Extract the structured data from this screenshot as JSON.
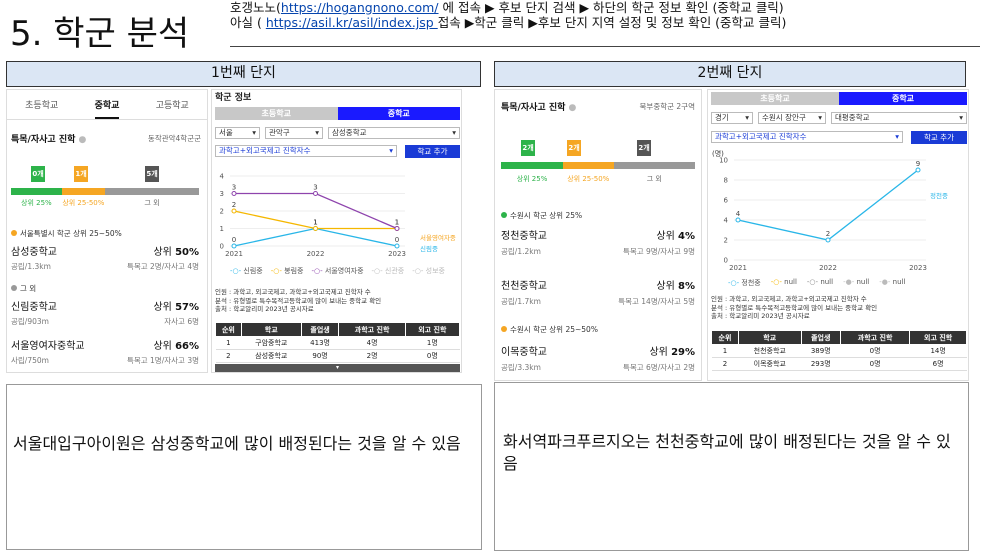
{
  "page": {
    "title": "5. 학군 분석",
    "instruction_line1_pre": "호갱노노(",
    "instruction_line1_link": "https://hogangnono.com/",
    "instruction_line1_post": " 에 접속 ▶ 후보 단지 검색 ▶ 하단의 학군 정보 확인 (중학교 클릭)",
    "instruction_line2_pre": "아실 ( ",
    "instruction_line2_link": "https://asil.kr/asil/index.jsp ",
    "instruction_line2_post": "접속 ▶학군 클릭 ▶후보 단지 지역 설정 및 정보 확인 (중학교 클릭)"
  },
  "panel1": {
    "heading": "1번째 단지",
    "tabs": [
      "초등학교",
      "중학교",
      "고등학교"
    ],
    "section_title": "특목/자사고 진학",
    "district": "동작관악4학군군",
    "flags": [
      "0개",
      "1개",
      "5개"
    ],
    "legend": [
      "상위 25%",
      "상위 25-50%",
      "그 외"
    ],
    "group1_label": "서울특별시 학군 상위 25~50%",
    "group2_label": "그 외",
    "schools": [
      {
        "name": "삼성중학교",
        "pct_prefix": "상위 ",
        "pct": "50%",
        "meta_left": "공립/1.3km",
        "meta_right": "특목고 2명/자사고 4명"
      },
      {
        "name": "신림중학교",
        "pct_prefix": "상위 ",
        "pct": "57%",
        "meta_left": "공립/903m",
        "meta_right": "자사고 6명"
      },
      {
        "name": "서울영여자중학교",
        "pct_prefix": "상위 ",
        "pct": "66%",
        "meta_left": "사립/750m",
        "meta_right": "특목고 1명/자사고 3명"
      }
    ],
    "asil": {
      "title": "학군 정보",
      "seg_left": "초등학교",
      "seg_right": "중학교",
      "sel1": "서울",
      "sel2": "관악구",
      "sel3": "삼성중학교",
      "sel_metric": "과학고+외고국제고 진학자수",
      "add_button": "학교 추가",
      "series_labels": [
        "서울영여자중",
        "신림중"
      ],
      "legend": [
        "신림중",
        "봉림중",
        "서울영여자중",
        "신관중",
        "성보중"
      ],
      "notes": [
        "인원 : 과학고, 외고국제고, 과학고+외고국제고 진학자 수",
        "분석 : 유형별로 특수목적고등학교에 많이 보내는 중학교 확인",
        "출처 : 학교알리미 2023년 공시자료"
      ],
      "table_headers": [
        "순위",
        "학교",
        "졸업생",
        "과학고 진학",
        "외고 진학"
      ],
      "table_rows": [
        [
          "1",
          "구암중학교",
          "413명",
          "4명",
          "1명"
        ],
        [
          "2",
          "삼성중학교",
          "90명",
          "2명",
          "0명"
        ]
      ]
    },
    "conclusion": "서울대입구아이원은 삼성중학교에 많이 배정된다는 것을 알 수 있음"
  },
  "panel2": {
    "heading": "2번째 단지",
    "section_title": "특목/자사고 진학",
    "district": "북부중학군 2구역",
    "flags": [
      "2개",
      "2개",
      "2개"
    ],
    "legend": [
      "상위 25%",
      "상위 25-50%",
      "그 외"
    ],
    "group1_label": "수원시 학군 상위 25%",
    "group2_label": "수원시 학군 상위 25~50%",
    "schools": [
      {
        "name": "정천중학교",
        "pct_prefix": "상위 ",
        "pct": "4%",
        "meta_left": "공립/1.2km",
        "meta_right": "특목고 9명/자사고 9명"
      },
      {
        "name": "천천중학교",
        "pct_prefix": "상위 ",
        "pct": "8%",
        "meta_left": "공립/1.7km",
        "meta_right": "특목고 14명/자사고 5명"
      },
      {
        "name": "이목중학교",
        "pct_prefix": "상위 ",
        "pct": "29%",
        "meta_left": "공립/3.3km",
        "meta_right": "특목고 6명/자사고 2명"
      }
    ],
    "asil": {
      "seg_left": "초등학교",
      "seg_right": "중학교",
      "sel1": "경기",
      "sel2": "수원시 장안구",
      "sel3": "대평중학교",
      "sel_metric": "과학고+외고국제고 진학자수",
      "add_button": "학교 추가",
      "unit": "(명)",
      "series_label": "정천중",
      "legend": [
        "정천중",
        "null",
        "null",
        "null",
        "null"
      ],
      "notes": [
        "인원 : 과학고, 외고국제고, 과학고+외고국제고 진학자 수",
        "분석 : 유형별로 특수목적고등학교에 많이 보내는 중학교 확인",
        "출처 : 학교알리미 2023년 공시자료"
      ],
      "table_headers": [
        "순위",
        "학교",
        "졸업생",
        "과학고 진학",
        "외고 진학"
      ],
      "table_rows": [
        [
          "1",
          "천천중학교",
          "389명",
          "0명",
          "14명"
        ],
        [
          "2",
          "이목중학교",
          "293명",
          "0명",
          "6명"
        ]
      ]
    },
    "conclusion": "화서역파크푸르지오는 천천중학교에 많이 배정된다는 것을 알 수 있음"
  },
  "chart_data": [
    {
      "type": "line",
      "x": [
        "2021",
        "2022",
        "2023"
      ],
      "ylim": [
        0,
        4
      ],
      "yticks": [
        0,
        1,
        2,
        3,
        4
      ],
      "series": [
        {
          "name": "신림중",
          "color": "#29b6e8",
          "values": [
            0,
            1,
            0
          ]
        },
        {
          "name": "봉림중",
          "color": "#f5b700",
          "values": [
            2,
            1,
            1
          ]
        },
        {
          "name": "서울영여자중",
          "color": "#8e44ad",
          "values": [
            3,
            3,
            1
          ]
        }
      ],
      "point_labels": [
        [
          "0",
          "1",
          "0"
        ],
        [
          "2",
          "1",
          "1"
        ],
        [
          "3",
          "3",
          "1"
        ]
      ]
    },
    {
      "type": "line",
      "x": [
        "2021",
        "2022",
        "2023"
      ],
      "ylim": [
        0,
        10
      ],
      "yticks": [
        0,
        2,
        4,
        6,
        8,
        10
      ],
      "series": [
        {
          "name": "정천중",
          "color": "#29b6e8",
          "values": [
            4,
            2,
            9
          ]
        }
      ],
      "point_labels": [
        [
          "4",
          "2",
          "9"
        ]
      ]
    }
  ]
}
